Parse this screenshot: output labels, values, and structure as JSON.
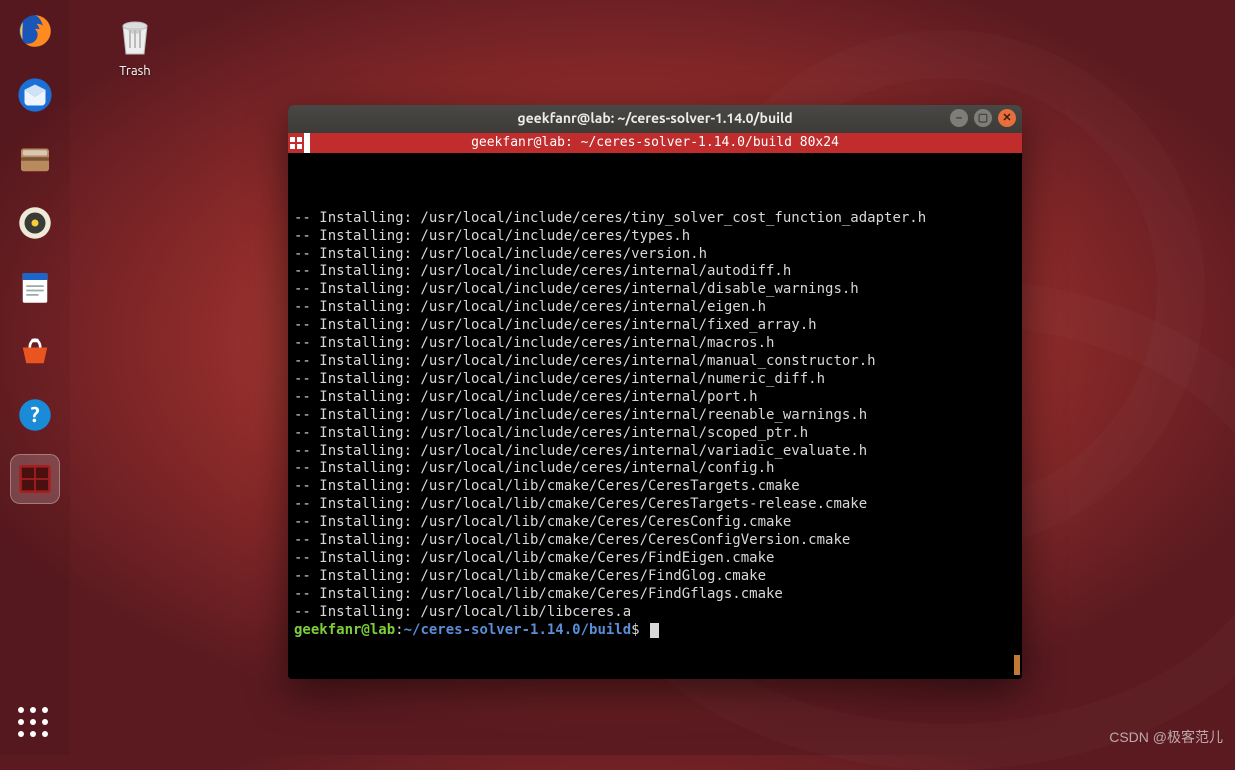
{
  "desktop": {
    "trash_label": "Trash"
  },
  "launcher": {
    "items": [
      {
        "name": "firefox-icon"
      },
      {
        "name": "thunderbird-icon"
      },
      {
        "name": "files-icon"
      },
      {
        "name": "rhythmbox-icon"
      },
      {
        "name": "writer-icon"
      },
      {
        "name": "software-icon"
      },
      {
        "name": "help-icon"
      },
      {
        "name": "terminal-icon",
        "active": true
      }
    ],
    "apps_name": "show-applications-icon"
  },
  "window": {
    "title": "geekfanr@lab: ~/ceres-solver-1.14.0/build",
    "byobu_status": "geekfanr@lab: ~/ceres-solver-1.14.0/build 80x24",
    "lines": [
      "-- Installing: /usr/local/include/ceres/tiny_solver_cost_function_adapter.h",
      "-- Installing: /usr/local/include/ceres/types.h",
      "-- Installing: /usr/local/include/ceres/version.h",
      "-- Installing: /usr/local/include/ceres/internal/autodiff.h",
      "-- Installing: /usr/local/include/ceres/internal/disable_warnings.h",
      "-- Installing: /usr/local/include/ceres/internal/eigen.h",
      "-- Installing: /usr/local/include/ceres/internal/fixed_array.h",
      "-- Installing: /usr/local/include/ceres/internal/macros.h",
      "-- Installing: /usr/local/include/ceres/internal/manual_constructor.h",
      "-- Installing: /usr/local/include/ceres/internal/numeric_diff.h",
      "-- Installing: /usr/local/include/ceres/internal/port.h",
      "-- Installing: /usr/local/include/ceres/internal/reenable_warnings.h",
      "-- Installing: /usr/local/include/ceres/internal/scoped_ptr.h",
      "-- Installing: /usr/local/include/ceres/internal/variadic_evaluate.h",
      "-- Installing: /usr/local/include/ceres/internal/config.h",
      "-- Installing: /usr/local/lib/cmake/Ceres/CeresTargets.cmake",
      "-- Installing: /usr/local/lib/cmake/Ceres/CeresTargets-release.cmake",
      "-- Installing: /usr/local/lib/cmake/Ceres/CeresConfig.cmake",
      "-- Installing: /usr/local/lib/cmake/Ceres/CeresConfigVersion.cmake",
      "-- Installing: /usr/local/lib/cmake/Ceres/FindEigen.cmake",
      "-- Installing: /usr/local/lib/cmake/Ceres/FindGlog.cmake",
      "-- Installing: /usr/local/lib/cmake/Ceres/FindGflags.cmake",
      "-- Installing: /usr/local/lib/libceres.a"
    ],
    "prompt": {
      "user": "geekfanr",
      "host": "lab",
      "path": "~/ceres-solver-1.14.0/build",
      "symbol": "$"
    }
  },
  "watermark": "CSDN @极客范儿"
}
